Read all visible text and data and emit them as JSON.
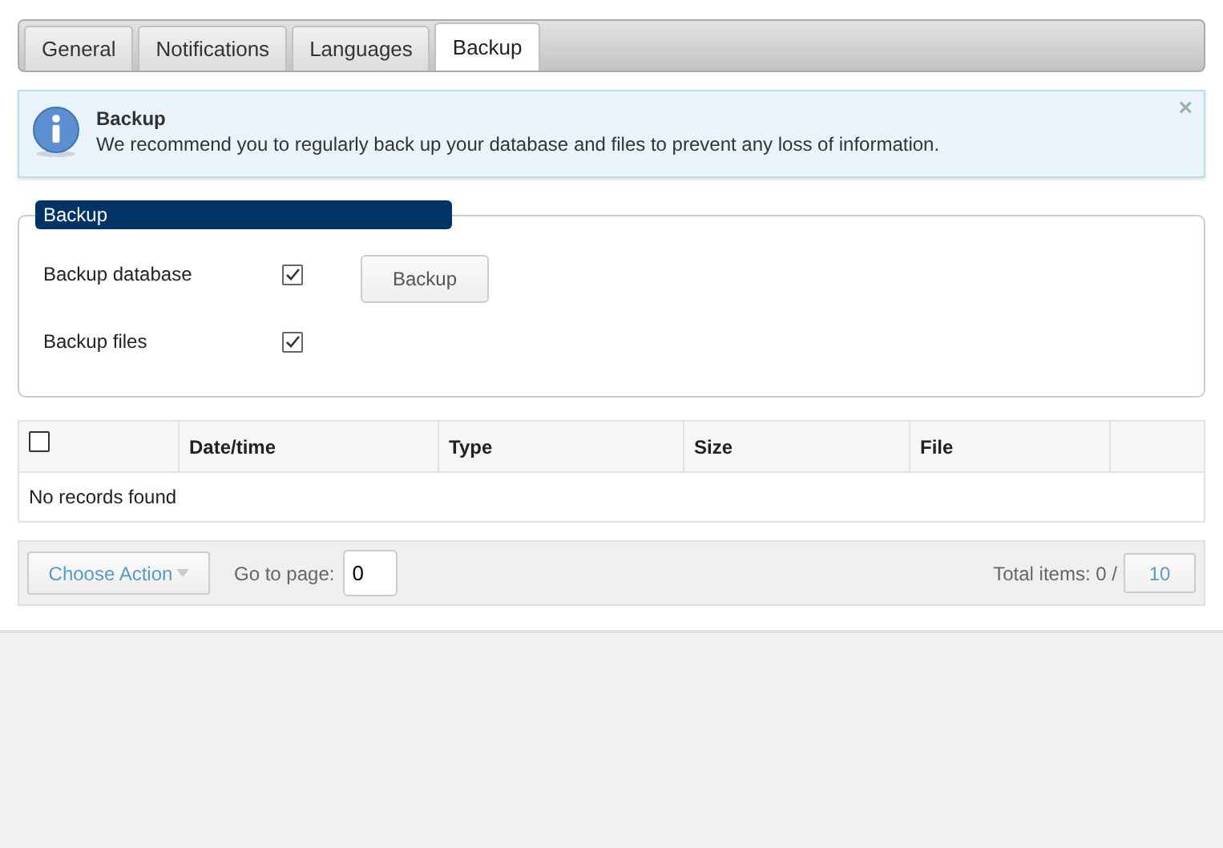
{
  "tabs": [
    {
      "label": "General",
      "selected": false
    },
    {
      "label": "Notifications",
      "selected": false
    },
    {
      "label": "Languages",
      "selected": false
    },
    {
      "label": "Backup",
      "selected": true
    }
  ],
  "info": {
    "title": "Backup",
    "message": "We recommend you to regularly back up your database and files to prevent any loss of information.",
    "close": "×"
  },
  "backup_panel": {
    "legend": "Backup",
    "options": [
      {
        "label": "Backup database",
        "checked": true
      },
      {
        "label": "Backup files",
        "checked": true
      }
    ],
    "button": "Backup"
  },
  "table": {
    "select_all_checked": false,
    "columns": [
      "Date/time",
      "Type",
      "Size",
      "File"
    ],
    "empty_message": "No records found"
  },
  "pager": {
    "action": "Choose Action",
    "goto_label": "Go to page:",
    "page": "0",
    "total_label": "Total items: 0 /",
    "page_size": "10"
  }
}
